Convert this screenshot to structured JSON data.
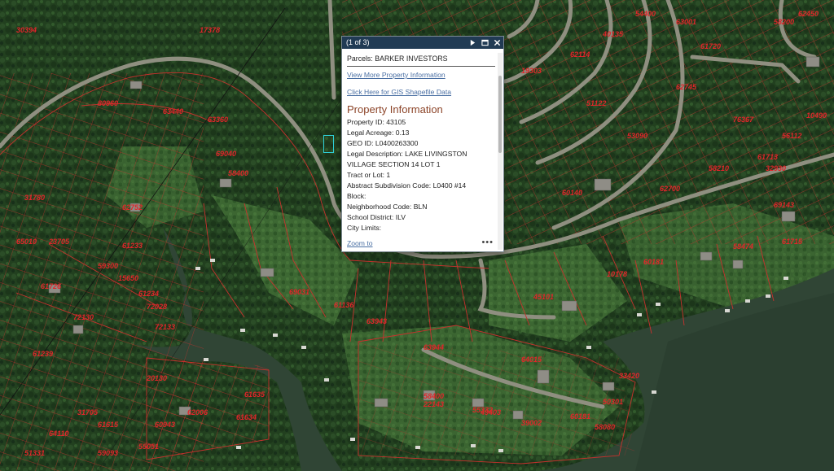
{
  "popup": {
    "counter": "(1 of 3)",
    "parcels_title": "Parcels: BARKER INVESTORS",
    "link_view_more": "View More Property Information",
    "link_gis": "Click Here for GIS Shapefile Data",
    "section_title": "Property Information",
    "fields": [
      {
        "label": "Property ID:",
        "value": "43105"
      },
      {
        "label": "Legal Acreage:",
        "value": "0.13"
      },
      {
        "label": "GEO ID:",
        "value": "L0400263300"
      },
      {
        "label": "Legal Description:",
        "value": "LAKE LIVINGSTON VILLAGE SECTION 14 LOT 1"
      },
      {
        "label": "Tract or Lot:",
        "value": "1"
      },
      {
        "label": "Abstract Subdivision Code:",
        "value": "L0400 #14"
      },
      {
        "label": "Block:",
        "value": ""
      },
      {
        "label": "Neighborhood Code:",
        "value": "BLN"
      },
      {
        "label": "School District:",
        "value": "ILV"
      },
      {
        "label": "City Limits:",
        "value": ""
      }
    ],
    "zoom_to": "Zoom to",
    "more_icon": "ellipsis-icon",
    "icons": [
      "next-icon",
      "maximize-icon",
      "close-icon"
    ]
  },
  "parcel_labels": [
    "30394",
    "17378",
    "80960",
    "63440",
    "63360",
    "69040",
    "58400",
    "62752",
    "31780",
    "65010",
    "23705",
    "59300",
    "15650",
    "61726",
    "72028",
    "69031",
    "61136",
    "63943",
    "63944",
    "64015",
    "10178",
    "60181",
    "58474",
    "61715",
    "61713",
    "69143",
    "45101",
    "61234",
    "61233",
    "72130",
    "72133",
    "61239",
    "20130",
    "31705",
    "61635",
    "61634",
    "62006",
    "61615",
    "60943",
    "64110",
    "51331",
    "55051",
    "59093",
    "58400",
    "55332",
    "49403",
    "60181",
    "39002",
    "22143",
    "33420",
    "50301",
    "58080",
    "19303",
    "62114",
    "40135",
    "54400",
    "63001",
    "61720",
    "62745",
    "76367",
    "58200",
    "62450",
    "10490",
    "56112",
    "32930",
    "58210",
    "62700",
    "53090",
    "51122",
    "60140"
  ],
  "colors": {
    "popup_header": "#213b54",
    "link": "#4a6fa3",
    "section_title": "#8c4428",
    "parcel": "#e0262a",
    "selection": "#2fd0d8"
  }
}
